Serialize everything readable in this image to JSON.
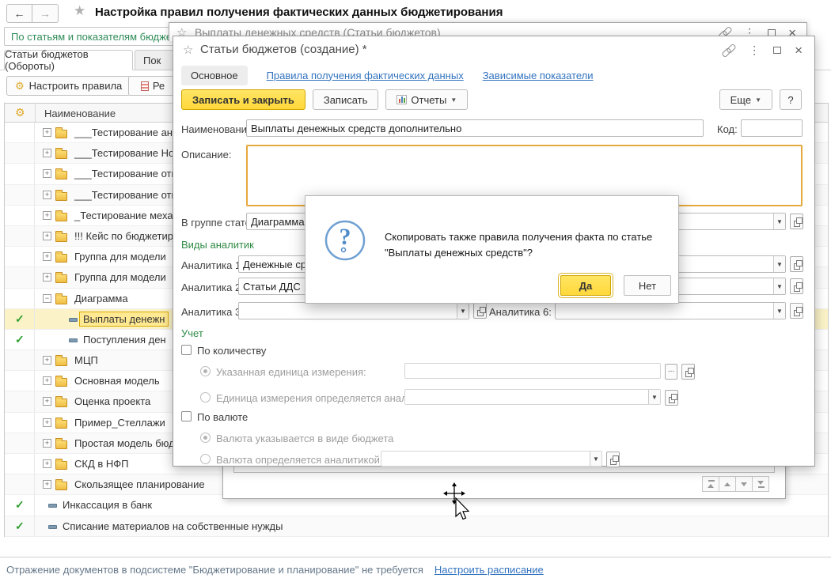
{
  "colors": {
    "accent_yellow": "#FFD83A",
    "focus_orange": "#E6A93C",
    "link_blue": "#3273BF",
    "section_green": "#2E8B45",
    "filter_green": "#2E8B57",
    "check_green": "#2E9E2E",
    "status_gray": "#66788A",
    "selected_row": "#FBF2C7"
  },
  "main_window": {
    "back": "←",
    "forward": "→",
    "title": "Настройка правил получения фактических данных бюджетирования",
    "filter_link": "По статьям и показателям бюджетов",
    "tab_active": "Статьи бюджетов (Обороты)",
    "tab_partial": "Пок",
    "btn_configure_rules": "Настроить правила",
    "btn_register_partial": "Ре",
    "tree_header": "Наименование",
    "tree_rows": [
      {
        "checked": false,
        "kind": "group",
        "expanded": false,
        "level": 0,
        "selected": false,
        "label": "___Тестирование ан"
      },
      {
        "checked": false,
        "kind": "group",
        "expanded": false,
        "level": 0,
        "selected": false,
        "label": "___Тестирование Но"
      },
      {
        "checked": false,
        "kind": "group",
        "expanded": false,
        "level": 0,
        "selected": false,
        "label": "___Тестирование отк"
      },
      {
        "checked": false,
        "kind": "group",
        "expanded": false,
        "level": 0,
        "selected": false,
        "label": "___Тестирование отк"
      },
      {
        "checked": false,
        "kind": "group",
        "expanded": false,
        "level": 0,
        "selected": false,
        "label": "_Тестирование меха"
      },
      {
        "checked": false,
        "kind": "group",
        "expanded": false,
        "level": 0,
        "selected": false,
        "label": "!!! Кейс по бюджетир"
      },
      {
        "checked": false,
        "kind": "group",
        "expanded": false,
        "level": 0,
        "selected": false,
        "label": "Группа для модели"
      },
      {
        "checked": false,
        "kind": "group",
        "expanded": false,
        "level": 0,
        "selected": false,
        "label": "Группа для модели"
      },
      {
        "checked": false,
        "kind": "group",
        "expanded": true,
        "level": 0,
        "selected": false,
        "label": "Диаграмма"
      },
      {
        "checked": true,
        "kind": "item",
        "expanded": false,
        "level": 1,
        "selected": true,
        "label": "Выплаты денежн"
      },
      {
        "checked": true,
        "kind": "item",
        "expanded": false,
        "level": 1,
        "selected": false,
        "label": "Поступления ден"
      },
      {
        "checked": false,
        "kind": "group",
        "expanded": false,
        "level": 0,
        "selected": false,
        "label": "МЦП"
      },
      {
        "checked": false,
        "kind": "group",
        "expanded": false,
        "level": 0,
        "selected": false,
        "label": "Основная модель"
      },
      {
        "checked": false,
        "kind": "group",
        "expanded": false,
        "level": 0,
        "selected": false,
        "label": "Оценка проекта"
      },
      {
        "checked": false,
        "kind": "group",
        "expanded": false,
        "level": 0,
        "selected": false,
        "label": "Пример_Стеллажи"
      },
      {
        "checked": false,
        "kind": "group",
        "expanded": false,
        "level": 0,
        "selected": false,
        "label": "Простая модель бюд"
      },
      {
        "checked": false,
        "kind": "group",
        "expanded": false,
        "level": 0,
        "selected": false,
        "label": "СКД в НФП"
      },
      {
        "checked": false,
        "kind": "group",
        "expanded": false,
        "level": 0,
        "selected": false,
        "label": "Скользящее планирование"
      },
      {
        "checked": true,
        "kind": "item",
        "expanded": false,
        "level": 0,
        "selected": false,
        "label": "Инкассация в банк"
      },
      {
        "checked": true,
        "kind": "item",
        "expanded": false,
        "level": 0,
        "selected": false,
        "label": "Списание материалов на собственные нужды"
      }
    ],
    "status_message": "Отражение документов в подсистеме \"Бюджетирование и планирование\" не требуется",
    "status_link": "Настроить расписание"
  },
  "payments_window": {
    "title": "Выплаты денежных средств (Статьи бюджетов)"
  },
  "creation_window": {
    "title": "Статьи бюджетов (создание) *",
    "tab_main": "Основное",
    "link_rules": "Правила получения фактических данных",
    "link_dependent": "Зависимые показатели",
    "btn_save_close": "Записать и закрыть",
    "btn_save": "Записать",
    "btn_reports": "Отчеты",
    "btn_more": "Еще",
    "btn_help": "?",
    "name_label": "Наименование:",
    "name_value": "Выплаты денежных средств дополнительно",
    "code_label": "Код:",
    "code_value": "",
    "description_label": "Описание:",
    "group_label": "В группе статей:",
    "group_value": "Диаграмма",
    "section_analytics": "Виды аналитик",
    "analytics1_label": "Аналитика 1:",
    "analytics1_value": "Денежные средс",
    "analytics2_label": "Аналитика 2:",
    "analytics2_value": "Статьи ДДС",
    "analytics3_label": "Аналитика 3:",
    "analytics3_value": "",
    "analytics6_label": "Аналитика 6:",
    "analytics6_value": "",
    "section_accounting": "Учет",
    "chk_quantity": "По количеству",
    "radio_unit_specified": "Указанная единица измерения:",
    "radio_unit_by_analytics": "Единица измерения определяется аналитикой:",
    "chk_currency": "По валюте",
    "radio_currency_budget": "Валюта указывается в виде бюджета",
    "radio_currency_analytics": "Валюта определяется аналитикой:"
  },
  "confirm_dialog": {
    "message": "Скопировать также правила получения факта по статье \"Выплаты денежных средств\"?",
    "btn_yes": "Да",
    "btn_no": "Нет"
  }
}
